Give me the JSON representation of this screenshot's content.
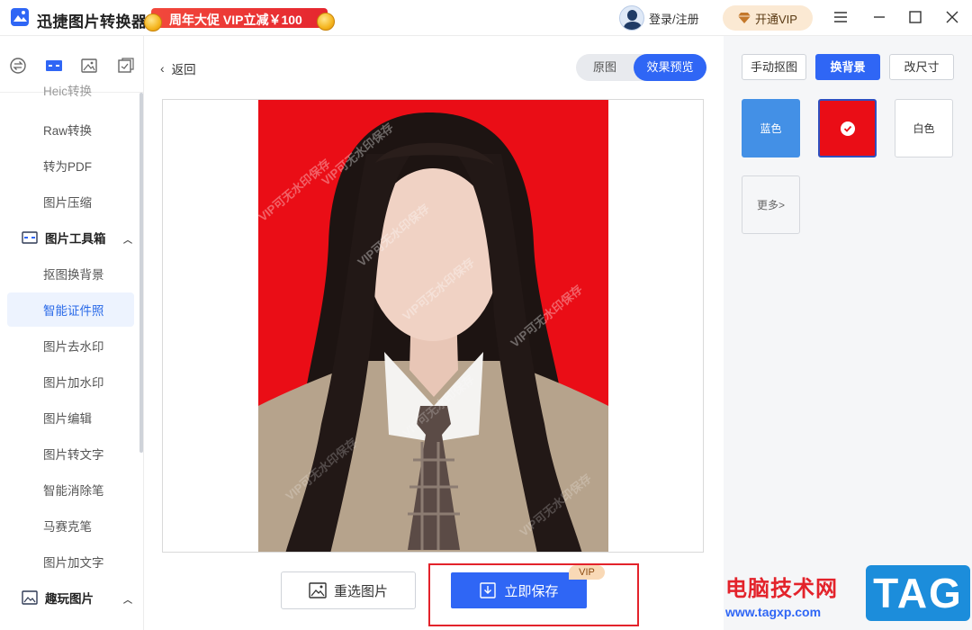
{
  "titlebar": {
    "app_title": "迅捷图片转换器",
    "promo_text": "周年大促 VIP立减￥100",
    "login_text": "登录/注册",
    "vip_button": "开通VIP"
  },
  "sidebar": {
    "partial_item": "Heic转换",
    "items_top": [
      {
        "label": "Raw转换"
      },
      {
        "label": "转为PDF"
      },
      {
        "label": "图片压缩"
      }
    ],
    "group_tools": "图片工具箱",
    "tools": [
      {
        "label": "抠图换背景"
      },
      {
        "label": "智能证件照"
      },
      {
        "label": "图片去水印"
      },
      {
        "label": "图片加水印"
      },
      {
        "label": "图片编辑"
      },
      {
        "label": "图片转文字"
      },
      {
        "label": "智能消除笔"
      },
      {
        "label": "马赛克笔"
      },
      {
        "label": "图片加文字"
      }
    ],
    "group_fun": "趣玩图片",
    "active_item": "智能证件照"
  },
  "main": {
    "back_label": "返回",
    "toggle_original": "原图",
    "toggle_preview": "效果预览",
    "watermark_text": "VIP可无水印保存",
    "reselect_label": "重选图片",
    "save_label": "立即保存",
    "vip_tag": "VIP"
  },
  "right_panel": {
    "tab_manual": "手动抠图",
    "tab_background": "换背景",
    "tab_size": "改尺寸",
    "swatch_blue": "蓝色",
    "swatch_white": "白色",
    "swatch_more": "更多>",
    "selected_color": "#ea0d16"
  },
  "site_watermark": {
    "name": "电脑技术网",
    "url": "www.tagxp.com",
    "logo": "TAG"
  }
}
